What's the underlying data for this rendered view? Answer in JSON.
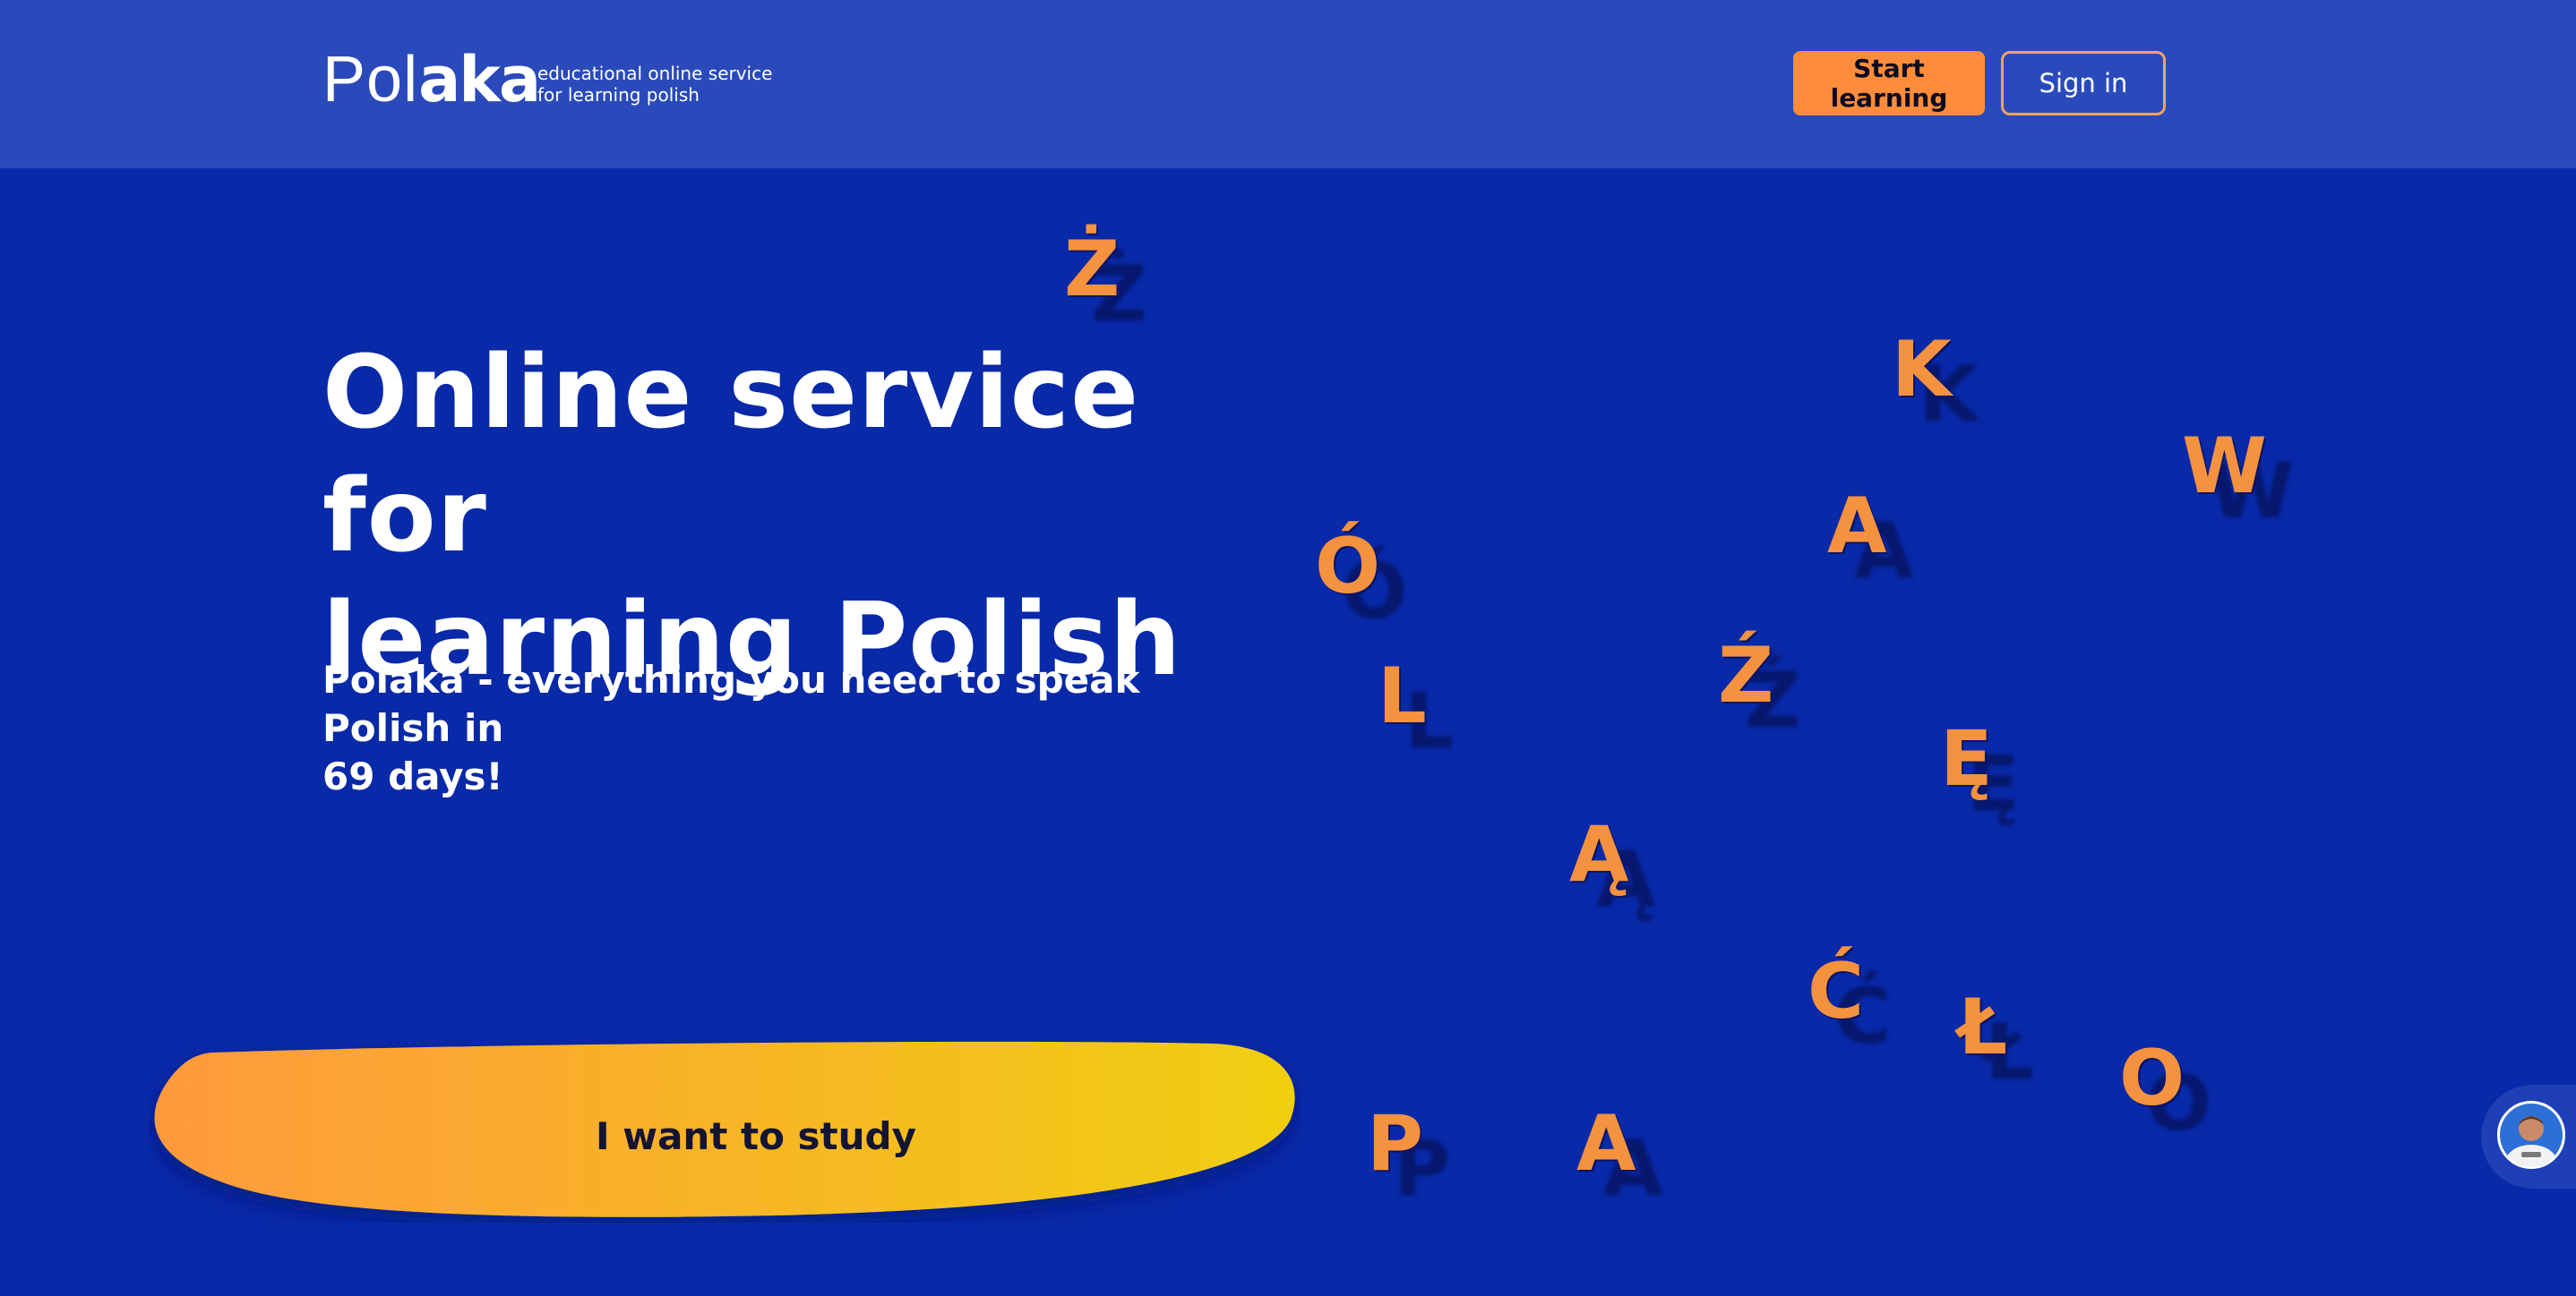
{
  "header": {
    "logo_thin": "Pol",
    "logo_bold": "aka",
    "tagline_line1": "educational online service",
    "tagline_line2": "for learning polish",
    "start_label": "Start learning",
    "signin_label": "Sign in"
  },
  "hero": {
    "title_line1": "Online service for",
    "title_line2": "learning Polish",
    "subtitle_line1": "Polaka - everything you need to speak Polish in",
    "subtitle_line2": "69 days!",
    "cta_label": "I want to study"
  },
  "letters": [
    "Ż",
    "K",
    "W",
    "A",
    "Ó",
    "Ź",
    "L",
    "Ę",
    "Ą",
    "Ć",
    "Ł",
    "O",
    "P",
    "A"
  ],
  "colors": {
    "background": "#0829a8",
    "header": "#2a4abb",
    "accent_orange": "#ff8c3a",
    "cta_gradient_start": "#ff9a3c",
    "cta_gradient_end": "#f0cf10",
    "letter": "#f5923f"
  },
  "icons": {
    "avatar": "support-avatar-icon"
  }
}
